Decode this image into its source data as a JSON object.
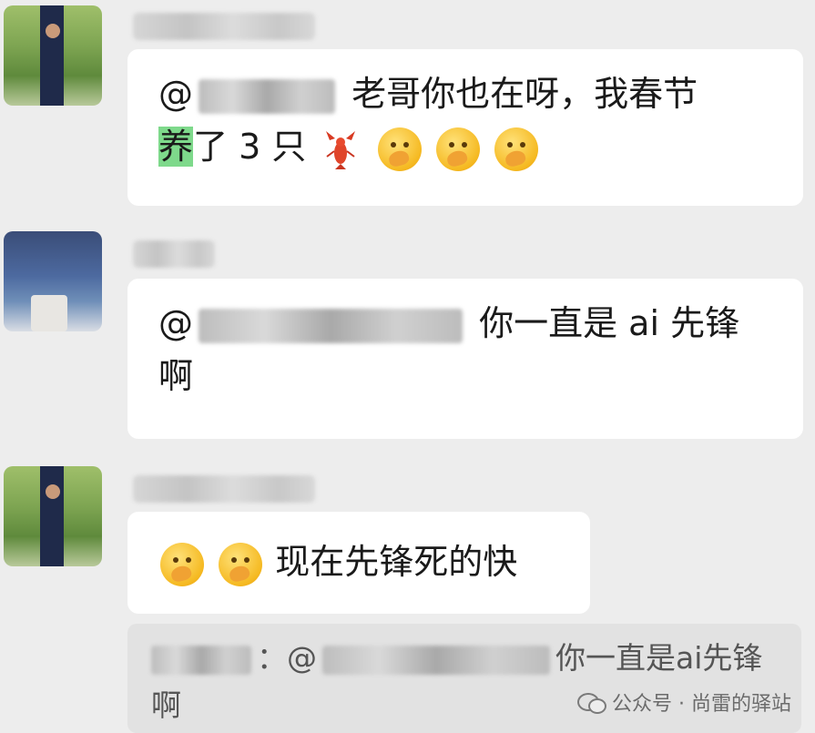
{
  "messages": [
    {
      "mention_prefix": "@",
      "text_1": "老哥你也在呀，我春节",
      "highlight": "养",
      "text_2": "了 3 只"
    },
    {
      "mention_prefix": "@",
      "text_1": "你一直是 ai 先锋",
      "text_2": "啊"
    },
    {
      "text_1": "现在先锋死的快"
    }
  ],
  "quote": {
    "mention_prefix": "：@",
    "text_1": "你一直是ai先锋",
    "text_2": "啊"
  },
  "watermark": {
    "text": "公众号 · 尚雷的驿站"
  },
  "emoji_names": [
    "lobster-emoji",
    "face-with-hand-over-mouth-emoji"
  ]
}
